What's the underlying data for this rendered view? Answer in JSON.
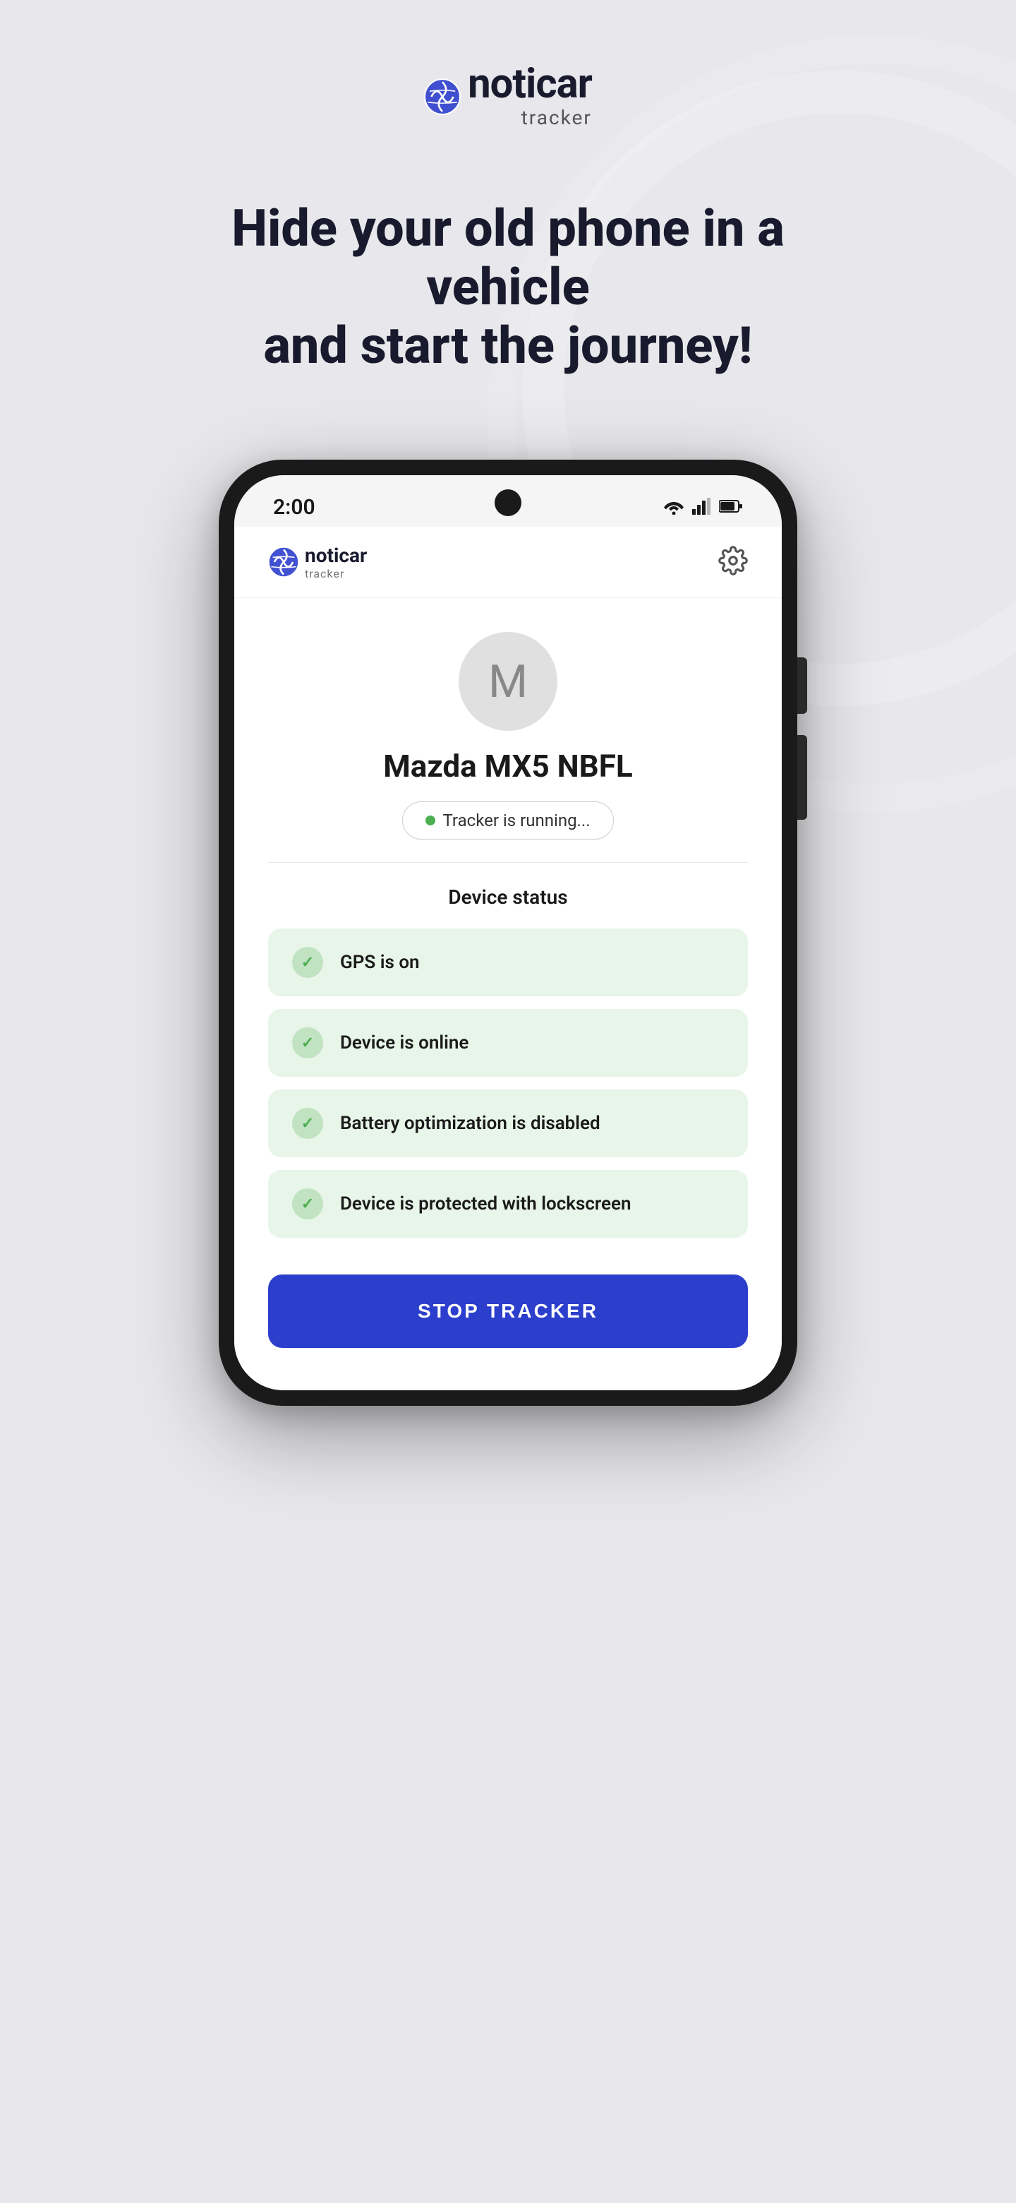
{
  "page": {
    "background_color": "#e8e8ec"
  },
  "top_logo": {
    "brand": "noticar",
    "sub": "tracker"
  },
  "headline": {
    "line1": "Hide your old phone in a vehicle",
    "line2": "and start the journey!"
  },
  "status_bar": {
    "time": "2:00"
  },
  "app_header": {
    "brand": "noticar",
    "sub": "tracker"
  },
  "avatar": {
    "letter": "M"
  },
  "car": {
    "name": "Mazda MX5 NBFL"
  },
  "tracker_badge": {
    "text": "Tracker is running..."
  },
  "device_status": {
    "section_title": "Device status",
    "items": [
      {
        "text": "GPS is on"
      },
      {
        "text": "Device is online"
      },
      {
        "text": "Battery optimization is disabled"
      },
      {
        "text": "Device is protected with lockscreen"
      }
    ]
  },
  "stop_button": {
    "label": "STOP TRACKER"
  }
}
